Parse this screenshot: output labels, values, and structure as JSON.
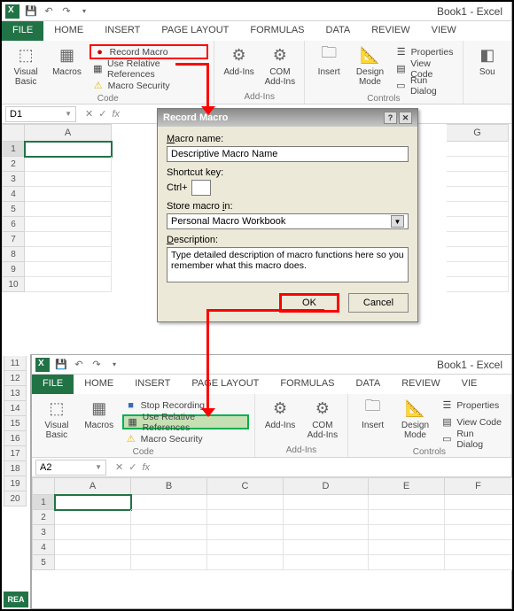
{
  "app": {
    "title": "Book1 - Excel"
  },
  "tabs": [
    "FILE",
    "HOME",
    "INSERT",
    "PAGE LAYOUT",
    "FORMULAS",
    "DATA",
    "REVIEW",
    "VIEW"
  ],
  "ribbon": {
    "code_group": "Code",
    "addins_group": "Add-Ins",
    "controls_group": "Controls",
    "visual_basic": "Visual\nBasic",
    "macros": "Macros",
    "record_macro": "Record Macro",
    "stop_recording": "Stop Recording",
    "use_rel_refs": "Use Relative References",
    "macro_security": "Macro Security",
    "add_ins": "Add-Ins",
    "com_addins": "COM\nAdd-Ins",
    "insert": "Insert",
    "design_mode": "Design\nMode",
    "properties": "Properties",
    "view_code": "View Code",
    "run_dialog": "Run Dialog",
    "sources": "Sou"
  },
  "namebox1": "D1",
  "namebox2": "A2",
  "columns1": [
    "A",
    "G"
  ],
  "rows1": [
    1,
    2,
    3,
    4,
    5,
    6,
    7,
    8,
    9,
    10
  ],
  "leftrows": [
    11,
    12,
    13,
    14,
    15,
    16,
    17,
    18,
    19,
    20
  ],
  "columns2": [
    "A",
    "B",
    "C",
    "D",
    "E",
    "F"
  ],
  "rows2": [
    1,
    2,
    3,
    4,
    5
  ],
  "dialog": {
    "title": "Record Macro",
    "macro_name_label": "Macro name:",
    "macro_name": "Descriptive Macro Name",
    "shortcut_label": "Shortcut key:",
    "ctrl": "Ctrl+",
    "store_label": "Store macro in:",
    "store_value": "Personal Macro Workbook",
    "desc_label": "Description:",
    "desc_value": "Type detailed description of macro functions here so you remember what this macro does.",
    "ok": "OK",
    "cancel": "Cancel"
  },
  "ready": "REA"
}
